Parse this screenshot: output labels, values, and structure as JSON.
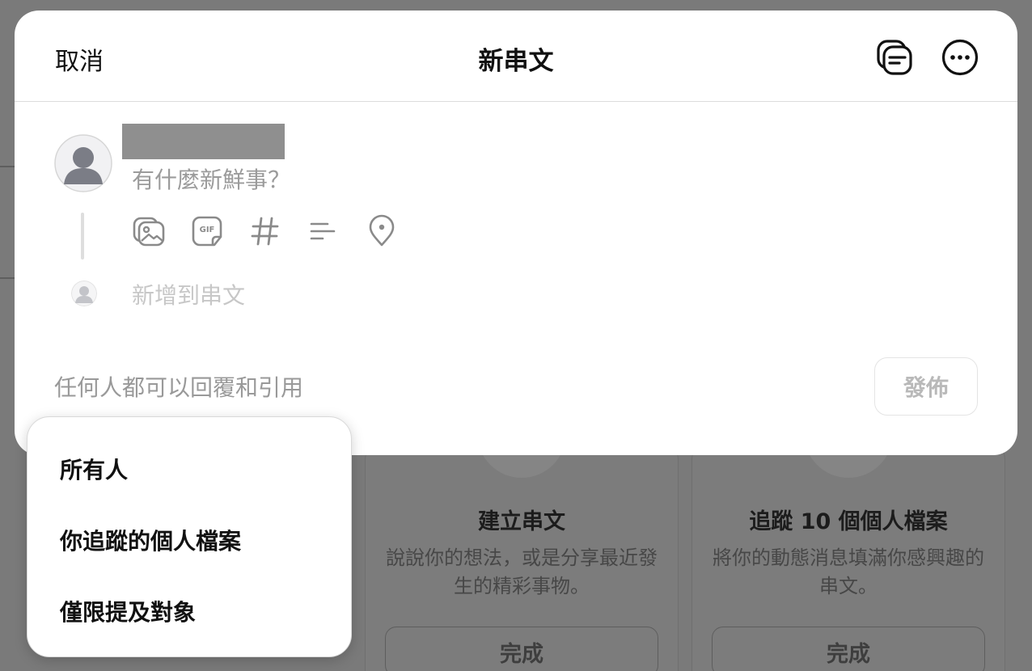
{
  "modal": {
    "cancel_label": "取消",
    "title": "新串文",
    "draft_icon": "drafts-icon",
    "more_icon": "more-options-icon"
  },
  "composer": {
    "placeholder": "有什麼新鮮事？",
    "add_to_thread": "新增到串文",
    "reply_setting": "任何人都可以回覆和引用",
    "post_label": "發佈",
    "tools": [
      "image-icon",
      "gif-icon",
      "hashtag-icon",
      "poll-icon",
      "location-icon"
    ]
  },
  "reply_menu": {
    "items": [
      "所有人",
      "你追蹤的個人檔案",
      "僅限提及對象"
    ]
  },
  "background": {
    "cards": [
      {
        "title": "建立串文",
        "description": "說說你的想法，或是分享最近發生的精彩事物。",
        "button": "完成"
      },
      {
        "title": "追蹤 10 個個人檔案",
        "description": "將你的動態消息填滿你感興趣的串文。",
        "button": "完成"
      }
    ]
  },
  "colors": {
    "overlay": "#7a7a7a",
    "modal_bg": "#ffffff",
    "text_primary": "#111111",
    "text_placeholder": "#9b9b9b"
  }
}
